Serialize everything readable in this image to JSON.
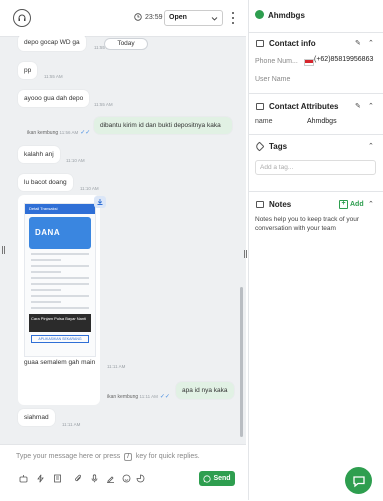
{
  "header": {
    "timer": "23:59",
    "status": "Open"
  },
  "messages": {
    "top_partial": "depo gocap WD ga",
    "top_partial_time": "11:55 AM",
    "today_label": "Today",
    "items": [
      {
        "text": "pp",
        "time": "11:55 AM"
      },
      {
        "text": "ayooo gua dah depo",
        "time": "11:55 AM"
      },
      {
        "text": "dibantu kirim id dan bukti depositnya kaka",
        "sender": "ikan kembung",
        "time": "11:56 AM"
      },
      {
        "text": "kalahh anj",
        "time": "11:10 AM"
      },
      {
        "text": "lu bacot doang",
        "time": "11:10 AM"
      },
      {
        "text": "guaa semalem gah main",
        "time": "11:11 AM"
      },
      {
        "text": "apa id nya kaka",
        "sender": "ikan kembung",
        "time": "11:11 AM"
      },
      {
        "text": "siahmad",
        "time": "11:11 AM"
      }
    ],
    "image": {
      "app_title": "Detail Transaksi",
      "logo_text": "DANA",
      "banner_text": "Cara Pinjam Pulsa Bayar Nanti",
      "button_text": "APLIKASIKAN SEKARANG"
    }
  },
  "composer": {
    "placeholder_pre": "Type your message here or press",
    "shortcut": "/",
    "placeholder_post": "key for quick replies.",
    "send_label": "Send"
  },
  "contact": {
    "name": "Ahmdbgs",
    "info_title": "Contact info",
    "phone_label": "Phone Num...",
    "phone_value": "(+62)85819956863",
    "username_label": "User Name",
    "attributes_title": "Contact Attributes",
    "attr_name_label": "name",
    "attr_name_value": "Ahmdbgs",
    "tags_title": "Tags",
    "tag_placeholder": "Add a tag...",
    "notes_title": "Notes",
    "notes_add": "Add",
    "notes_desc": "Notes help you to keep track of your conversation with your team"
  },
  "colors": {
    "accent": "#2e9e4f",
    "outgoing_bubble": "#e1f1e4",
    "chat_bg": "#eef0f2",
    "tick": "#4a90e2"
  }
}
